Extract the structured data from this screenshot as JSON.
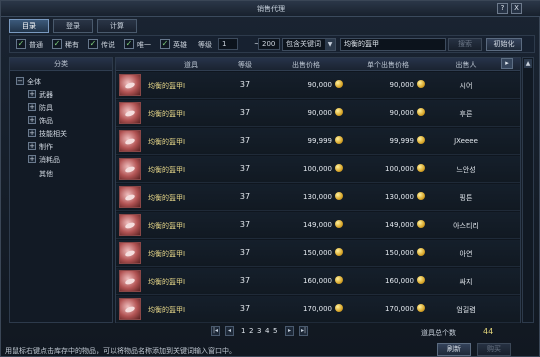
{
  "window": {
    "title": "销售代理",
    "help": "?",
    "close": "X"
  },
  "tabs": [
    {
      "label": "目录",
      "active": true
    },
    {
      "label": "登录",
      "active": false
    },
    {
      "label": "计算",
      "active": false
    }
  ],
  "filters": {
    "grades": [
      {
        "label": "普通",
        "checked": true
      },
      {
        "label": "稀有",
        "checked": true
      },
      {
        "label": "传说",
        "checked": true
      },
      {
        "label": "唯一",
        "checked": true
      },
      {
        "label": "英雄",
        "checked": true
      }
    ],
    "level_label": "等级",
    "level_min": "1",
    "level_sep": "~",
    "level_max": "200",
    "match_select": "包含关键词",
    "keyword": "均衡的盔甲",
    "search_button": "搜索",
    "reset_button": "初始化"
  },
  "category": {
    "header": "分类",
    "items": [
      {
        "label": "全体",
        "toggle": "−"
      },
      {
        "label": "武器",
        "toggle": "+"
      },
      {
        "label": "防具",
        "toggle": "+"
      },
      {
        "label": "饰品",
        "toggle": "+"
      },
      {
        "label": "技能相关",
        "toggle": "+"
      },
      {
        "label": "制作",
        "toggle": "+"
      },
      {
        "label": "消耗品",
        "toggle": "+"
      },
      {
        "label": "其他",
        "toggle": ""
      }
    ]
  },
  "table": {
    "headers": {
      "item": "道具",
      "level": "等级",
      "price": "出售价格",
      "unit_price": "单个出售价格",
      "seller": "出售人"
    },
    "rows": [
      {
        "name": "均衡的盔甲I",
        "level": "37",
        "price": "90,000",
        "unit_price": "90,000",
        "seller": "시어"
      },
      {
        "name": "均衡的盔甲I",
        "level": "37",
        "price": "90,000",
        "unit_price": "90,000",
        "seller": "후른"
      },
      {
        "name": "均衡的盔甲I",
        "level": "37",
        "price": "99,999",
        "unit_price": "99,999",
        "seller": "JXeeee"
      },
      {
        "name": "均衡的盔甲I",
        "level": "37",
        "price": "100,000",
        "unit_price": "100,000",
        "seller": "느안성"
      },
      {
        "name": "均衡的盔甲I",
        "level": "37",
        "price": "130,000",
        "unit_price": "130,000",
        "seller": "핑튼"
      },
      {
        "name": "均衡的盔甲I",
        "level": "37",
        "price": "149,000",
        "unit_price": "149,000",
        "seller": "아스티리"
      },
      {
        "name": "均衡的盔甲I",
        "level": "37",
        "price": "150,000",
        "unit_price": "150,000",
        "seller": "아연"
      },
      {
        "name": "均衡的盔甲I",
        "level": "37",
        "price": "160,000",
        "unit_price": "160,000",
        "seller": "싸지"
      },
      {
        "name": "均衡的盔甲I",
        "level": "37",
        "price": "170,000",
        "unit_price": "170,000",
        "seller": "엄길렴"
      }
    ]
  },
  "pager": {
    "first": "|◂",
    "prev": "◂",
    "pages": [
      "1",
      "2",
      "3",
      "4",
      "5"
    ],
    "next": "▸",
    "last": "▸|"
  },
  "total": {
    "label": "道具总个数",
    "value": "44"
  },
  "status": "用鼠标右键点击库存中的物品，可以将物品名称添加到关键词输入窗口中。",
  "footer_buttons": {
    "refresh": "刷新",
    "buy": "购买"
  },
  "colors": {
    "item_name": "#e9d98a",
    "active_tab": "#3c5a7b",
    "coin": "#d9a72a"
  }
}
